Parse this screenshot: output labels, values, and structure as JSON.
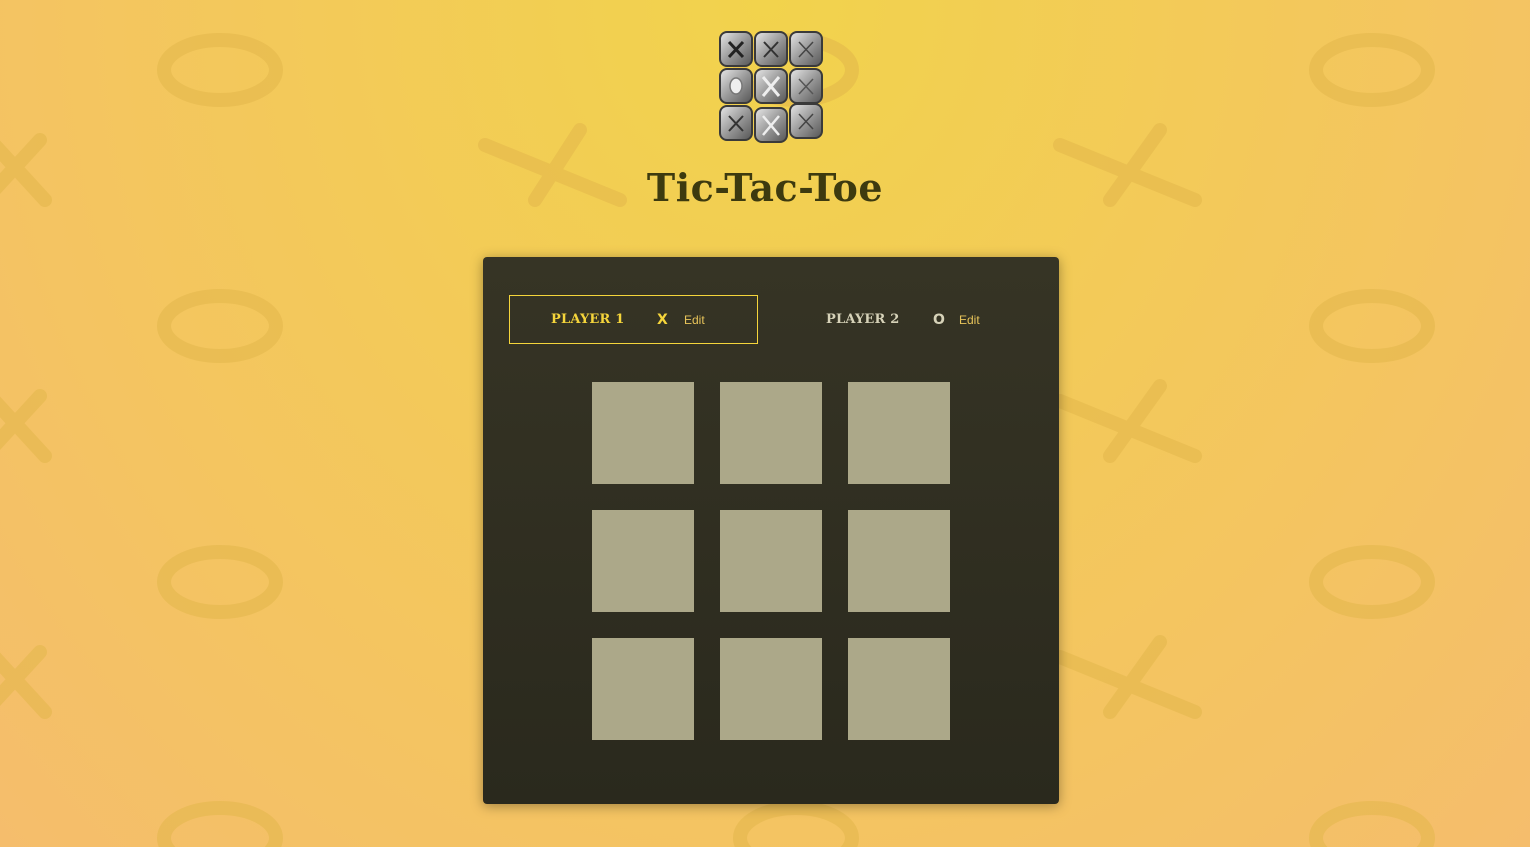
{
  "app": {
    "title": "Tic-Tac-Toe",
    "logo_icon": "tic-tac-toe-logo-icon"
  },
  "colors": {
    "background_top": "#f2d34c",
    "background_bottom": "#f5bd6c",
    "panel": "#2e2d20",
    "accent": "#f5d53b",
    "cell": "#aca889",
    "title": "#3d3a0f"
  },
  "players": [
    {
      "name": "PLAYER 1",
      "symbol": "X",
      "edit_label": "Edit",
      "active": true
    },
    {
      "name": "PLAYER 2",
      "symbol": "O",
      "edit_label": "Edit",
      "active": false
    }
  ],
  "board": {
    "cells": [
      "",
      "",
      "",
      "",
      "",
      "",
      "",
      "",
      ""
    ]
  }
}
